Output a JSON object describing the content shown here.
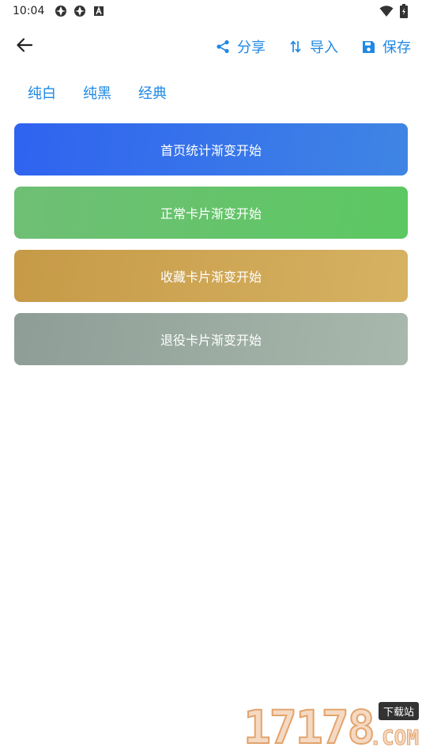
{
  "status_bar": {
    "time": "10:04",
    "icons_left": [
      "app-icon-1",
      "app-icon-2",
      "font-icon"
    ],
    "icons_right": [
      "wifi-icon",
      "battery-icon"
    ]
  },
  "toolbar": {
    "back_icon": "arrow-back-icon",
    "share_label": "分享",
    "import_label": "导入",
    "save_label": "保存"
  },
  "theme_tabs": [
    "纯白",
    "纯黑",
    "经典"
  ],
  "gradient_buttons": [
    {
      "label": "首页统计渐变开始",
      "color_start": "#2f63f0",
      "color_end": "#3f85e4"
    },
    {
      "label": "正常卡片渐变开始",
      "color_start": "#6fbf75",
      "color_end": "#5cc862"
    },
    {
      "label": "收藏卡片渐变开始",
      "color_start": "#c69a47",
      "color_end": "#d6b262"
    },
    {
      "label": "退役卡片渐变开始",
      "color_start": "#8e9e97",
      "color_end": "#a8b8ac"
    }
  ],
  "watermark": {
    "number": "17178",
    "badge": "下载站",
    "domain": ".COM"
  },
  "colors": {
    "accent": "#1e88e5",
    "background": "#ffffff"
  }
}
